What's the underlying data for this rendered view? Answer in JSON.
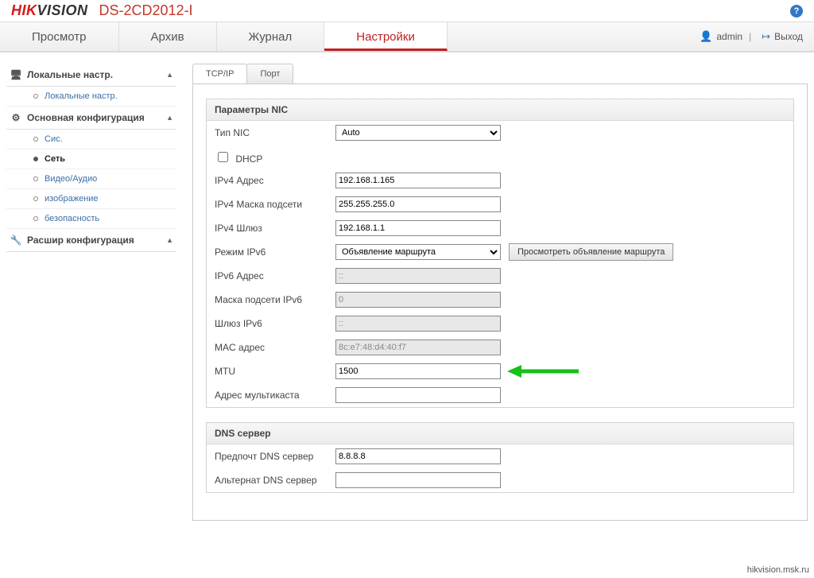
{
  "header": {
    "brand_left": "HIK",
    "brand_right": "VISION",
    "model": "DS-2CD2012-I"
  },
  "nav": {
    "tabs": [
      "Просмотр",
      "Архив",
      "Журнал",
      "Настройки"
    ],
    "active_index": 3,
    "user": "admin",
    "logout": "Выход"
  },
  "sidebar": {
    "groups": [
      {
        "title": "Локальные настр.",
        "icon": "monitor",
        "items": [
          {
            "label": "Локальные настр.",
            "active": false
          }
        ]
      },
      {
        "title": "Основная конфигурация",
        "icon": "gear",
        "items": [
          {
            "label": "Сис.",
            "active": false
          },
          {
            "label": "Сеть",
            "active": true
          },
          {
            "label": "Видео/Аудио",
            "active": false
          },
          {
            "label": "изображение",
            "active": false
          },
          {
            "label": "безопасность",
            "active": false
          }
        ]
      },
      {
        "title": "Расшир конфигурация",
        "icon": "wrench",
        "items": []
      }
    ]
  },
  "subtabs": {
    "items": [
      "TCP/IP",
      "Порт"
    ],
    "active_index": 0
  },
  "nic": {
    "section_title": "Параметры NIC",
    "type_label": "Тип NIC",
    "type_value": "Auto",
    "dhcp_label": "DHCP",
    "dhcp_checked": false,
    "ipv4_addr_label": "IPv4 Адрес",
    "ipv4_addr_value": "192.168.1.165",
    "ipv4_mask_label": "IPv4 Маска подсети",
    "ipv4_mask_value": "255.255.255.0",
    "ipv4_gw_label": "IPv4 Шлюз",
    "ipv4_gw_value": "192.168.1.1",
    "ipv6_mode_label": "Режим IPv6",
    "ipv6_mode_value": "Объявление маршрута",
    "ipv6_mode_btn": "Просмотреть объявление маршрута",
    "ipv6_addr_label": "IPv6 Адрес",
    "ipv6_addr_value": "::",
    "ipv6_mask_label": "Маска подсети IPv6",
    "ipv6_mask_value": "0",
    "ipv6_gw_label": "Шлюз IPv6",
    "ipv6_gw_value": "::",
    "mac_label": "MAC адрес",
    "mac_value": "8c:e7:48:d4:40:f7",
    "mtu_label": "MTU",
    "mtu_value": "1500",
    "multicast_label": "Адрес мультикаста",
    "multicast_value": ""
  },
  "dns": {
    "section_title": "DNS сервер",
    "pref_label": "Предпочт DNS сервер",
    "pref_value": "8.8.8.8",
    "alt_label": "Альтернат DNS сервер",
    "alt_value": ""
  },
  "watermark": "hikvision.msk.ru"
}
